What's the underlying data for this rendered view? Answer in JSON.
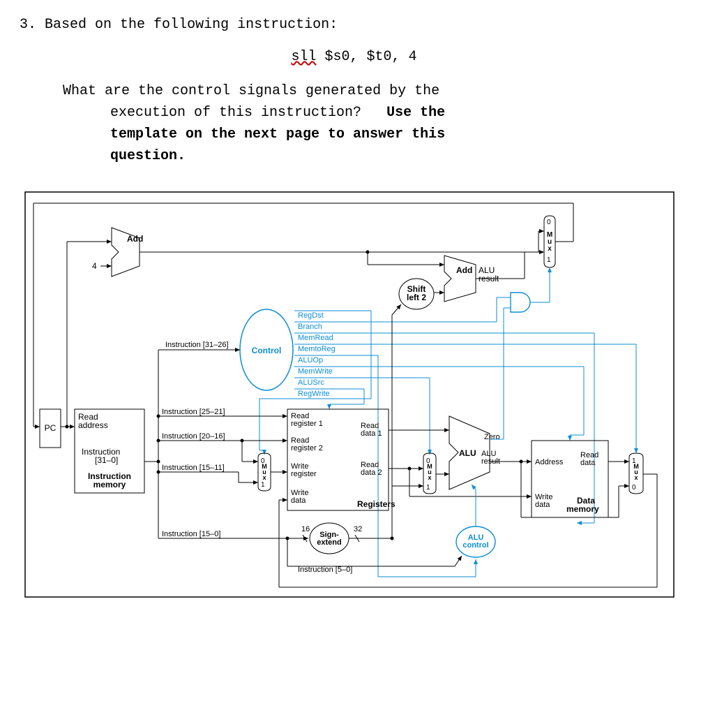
{
  "question": {
    "number": "3.",
    "prompt_line1": "Based on the following instruction:",
    "instruction_mnemonic": "sll",
    "instruction_args": "$s0, $t0, 4",
    "para_line1": "What are the control signals generated by the",
    "para_line2": "execution of this instruction?",
    "para_line2b": "Use the",
    "para_line3": "template on the next page to answer this",
    "para_line4": "question."
  },
  "diagram": {
    "add_left": "Add",
    "four": "4",
    "control": "Control",
    "control_out": {
      "regdst": "RegDst",
      "branch": "Branch",
      "memread": "MemRead",
      "memtoreg": "MemtoReg",
      "aluop": "ALUOp",
      "memwrite": "MemWrite",
      "alusrc": "ALUSrc",
      "regwrite": "RegWrite"
    },
    "instr_fields": {
      "f31_26": "Instruction [31–26]",
      "f25_21": "Instruction [25–21]",
      "f20_16": "Instruction [20–16]",
      "f15_11": "Instruction [15–11]",
      "f15_0": "Instruction [15–0]",
      "f5_0": "Instruction [5–0]",
      "f31_0": "Instruction\n[31–0]"
    },
    "pc": "PC",
    "read_addr": "Read\naddress",
    "instr_mem": "Instruction\nmemory",
    "regfile": {
      "read_reg1": "Read\nregister 1",
      "read_reg2": "Read\nregister 2",
      "write_reg": "Write\nregister",
      "write_data": "Write\ndata",
      "read_d1": "Read\ndata 1",
      "read_d2": "Read\ndata 2",
      "label": "Registers"
    },
    "sign_ext": "Sign-\nextend",
    "sign16": "16",
    "sign32": "32",
    "shift_left": "Shift\nleft 2",
    "add_right": "Add",
    "alu_result_top": "ALU\nresult",
    "alu": "ALU",
    "alu_result": "ALU\nresult",
    "zero": "Zero",
    "alu_control": "ALU\ncontrol",
    "dmem": {
      "address": "Address",
      "read_data": "Read\ndata",
      "write_data": "Write\ndata",
      "label": "Data\nmemory"
    },
    "mux": "M\nu\nx",
    "mux0": "0",
    "mux1": "1"
  }
}
